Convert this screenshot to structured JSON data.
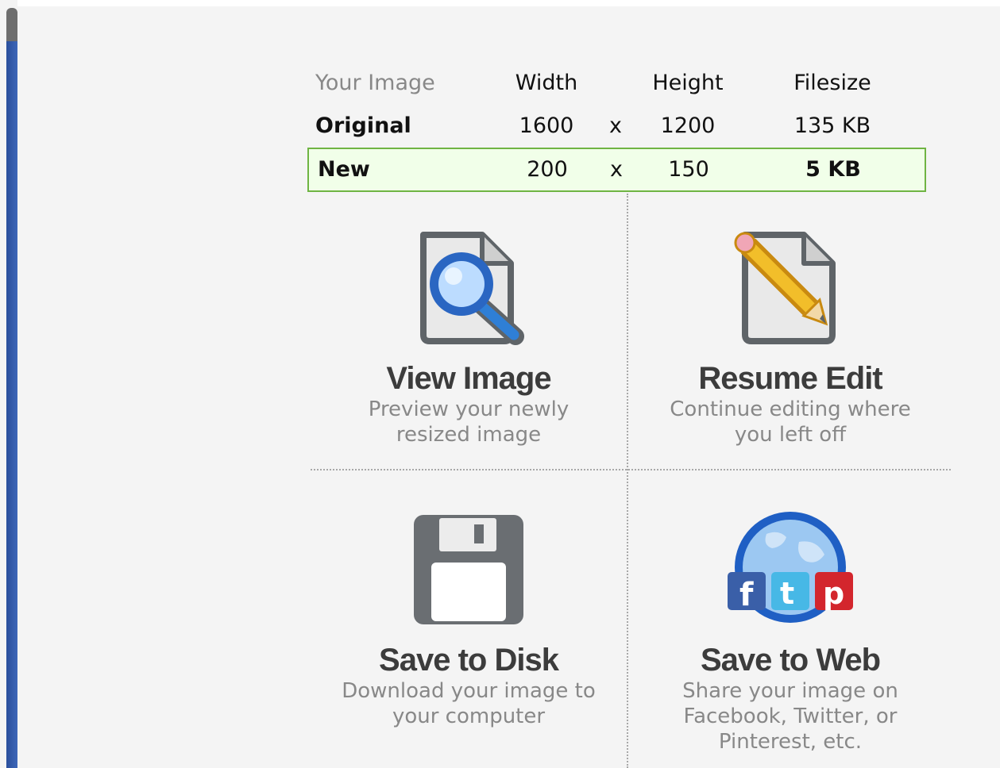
{
  "size_table": {
    "header": {
      "label": "Your Image",
      "width": "Width",
      "height": "Height",
      "filesize": "Filesize"
    },
    "original": {
      "label": "Original",
      "width": "1600",
      "sep": "x",
      "height": "1200",
      "filesize": "135 KB"
    },
    "new": {
      "label": "New",
      "width": "200",
      "sep": "x",
      "height": "150",
      "filesize": "5 KB"
    }
  },
  "options": {
    "view": {
      "title": "View Image",
      "desc": "Preview your newly resized image",
      "icon": "magnifier-document-icon"
    },
    "edit": {
      "title": "Resume Edit",
      "desc": "Continue editing where you left off",
      "icon": "pencil-document-icon"
    },
    "disk": {
      "title": "Save to Disk",
      "desc": "Download your image to your computer",
      "icon": "floppy-disk-icon"
    },
    "web": {
      "title": "Save to Web",
      "desc": "Share your image on Facebook, Twitter, or Pinterest, etc.",
      "icon": "globe-social-icon"
    }
  },
  "colors": {
    "new_row_border": "#6fb443",
    "new_row_bg": "#f1ffe9",
    "scrollbar": "#2a4f9c"
  }
}
